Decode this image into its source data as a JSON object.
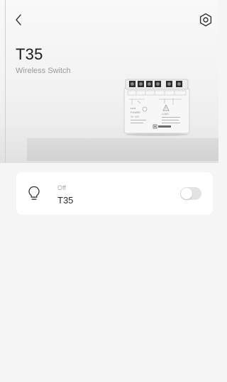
{
  "header": {
    "device_name": "T35",
    "device_type": "Wireless Switch"
  },
  "icons": {
    "back": "chevron-left-icon",
    "settings": "gear-icon",
    "bulb": "lightbulb-icon"
  },
  "device_image": {
    "brand_label": "ezviz",
    "power_label": "POWER",
    "load_label": "LOAD",
    "voltage_label": "3V~12V"
  },
  "channel": {
    "state": "Off",
    "name": "T35",
    "toggle_on": false
  },
  "colors": {
    "background": "#f5f5f5",
    "card": "#ffffff",
    "toggle_off": "#e3e3e3",
    "secondary_text": "#9a9a9a"
  }
}
